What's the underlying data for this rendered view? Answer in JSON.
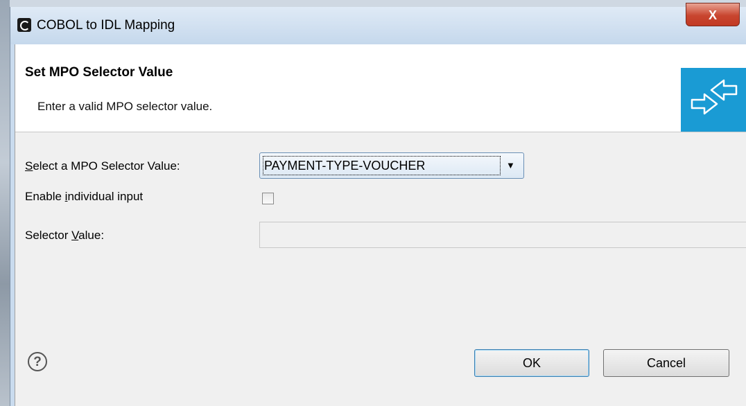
{
  "window": {
    "title": "COBOL to IDL Mapping",
    "close_label": "X"
  },
  "header": {
    "title": "Set MPO Selector Value",
    "description": "Enter a valid MPO selector value."
  },
  "form": {
    "selector_label_mnemonic": "S",
    "selector_label_rest": "elect a MPO Selector Value:",
    "selector_value": "PAYMENT-TYPE-VOUCHER",
    "individual_label_pre": "Enable ",
    "individual_label_mnemonic": "i",
    "individual_label_rest": "ndividual input",
    "individual_checked": false,
    "selector_value_label_pre": "Selector ",
    "selector_value_label_mnemonic": "V",
    "selector_value_label_rest": "alue:",
    "selector_value_input": ""
  },
  "footer": {
    "help_icon": "help-icon",
    "ok_label": "OK",
    "cancel_label": "Cancel"
  },
  "colors": {
    "accent": "#1a9bd4",
    "close": "#c8452f"
  }
}
